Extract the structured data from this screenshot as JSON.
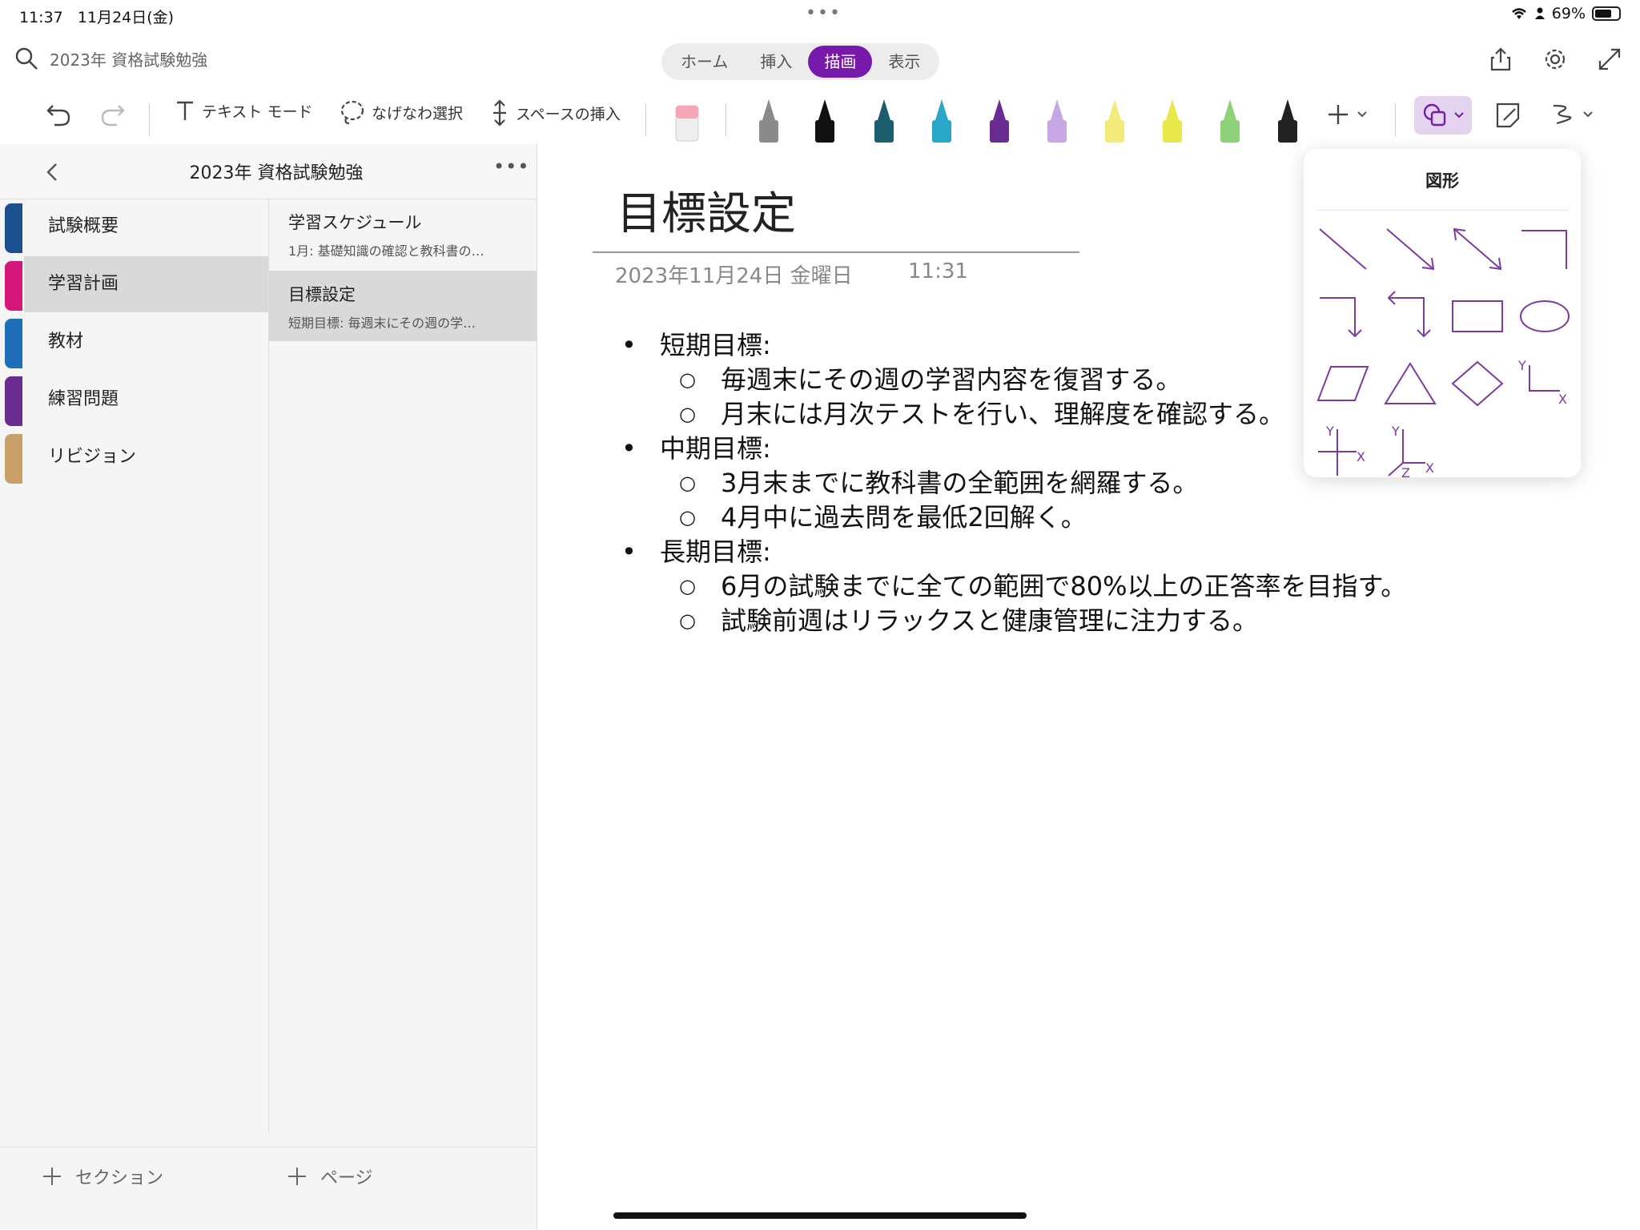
{
  "status_bar": {
    "time": "11:37",
    "date": "11月24日(金)",
    "battery": "69%"
  },
  "header": {
    "search_label": "2023年 資格試験勉強",
    "tabs": [
      {
        "label": "ホーム",
        "active": false
      },
      {
        "label": "挿入",
        "active": false
      },
      {
        "label": "描画",
        "active": true
      },
      {
        "label": "表示",
        "active": false
      }
    ]
  },
  "toolbar": {
    "text_mode": "テキスト モード",
    "lasso": "なげなわ選択",
    "insert_space": "スペースの挿入",
    "pens": [
      "#8a8a8a",
      "#111111",
      "#1b5e6e",
      "#2aa7c7",
      "#6a2c91",
      "#c7a7e6",
      "#f1ec7a",
      "#e8e84a",
      "#8fd07a",
      "#222222"
    ],
    "accent": "#7719aa"
  },
  "notebook": {
    "title": "2023年 資格試験勉強",
    "sections": [
      {
        "label": "試験概要",
        "color": "#1b4f8f",
        "active": false
      },
      {
        "label": "学習計画",
        "color": "#d6177a",
        "active": true
      },
      {
        "label": "教材",
        "color": "#1f6fb8",
        "active": false
      },
      {
        "label": "練習問題",
        "color": "#6b2c91",
        "active": false
      },
      {
        "label": "リビジョン",
        "color": "#c9a06a",
        "active": false
      }
    ],
    "pages": [
      {
        "title": "学習スケジュール",
        "preview": "1月: 基礎知識の確認と教科書の…",
        "active": false
      },
      {
        "title": "目標設定",
        "preview": "短期目標:  毎週末にその週の学…",
        "active": true
      }
    ],
    "add_section": "セクション",
    "add_page": "ページ"
  },
  "note": {
    "title": "目標設定",
    "date": "2023年11月24日 金曜日",
    "time": "11:31",
    "items": [
      {
        "level": 1,
        "text": "短期目標:"
      },
      {
        "level": 2,
        "text": "毎週末にその週の学習内容を復習する。"
      },
      {
        "level": 2,
        "text": "月末には月次テストを行い、理解度を確認する。"
      },
      {
        "level": 1,
        "text": "中期目標:"
      },
      {
        "level": 2,
        "text": "3月末までに教科書の全範囲を網羅する。"
      },
      {
        "level": 2,
        "text": "4月中に過去問を最低2回解く。"
      },
      {
        "level": 1,
        "text": "長期目標:"
      },
      {
        "level": 2,
        "text": "6月の試験までに全ての範囲で80%以上の正答率を目指す。"
      },
      {
        "level": 2,
        "text": "試験前週はリラックスと健康管理に注力する。"
      }
    ]
  },
  "shapes_popover": {
    "title": "図形",
    "shapes": [
      "line-shape",
      "arrow-shape",
      "double-arrow-shape",
      "elbow-connector-shape",
      "elbow-arrow-shape",
      "double-elbow-arrow-shape",
      "rectangle-shape",
      "ellipse-shape",
      "parallelogram-shape",
      "triangle-shape",
      "diamond-shape",
      "xy-axis-shape",
      "four-quadrant-axis-shape",
      "xyz-axis-shape"
    ],
    "axis_labels": {
      "x": "X",
      "y": "Y",
      "z": "Z"
    }
  }
}
